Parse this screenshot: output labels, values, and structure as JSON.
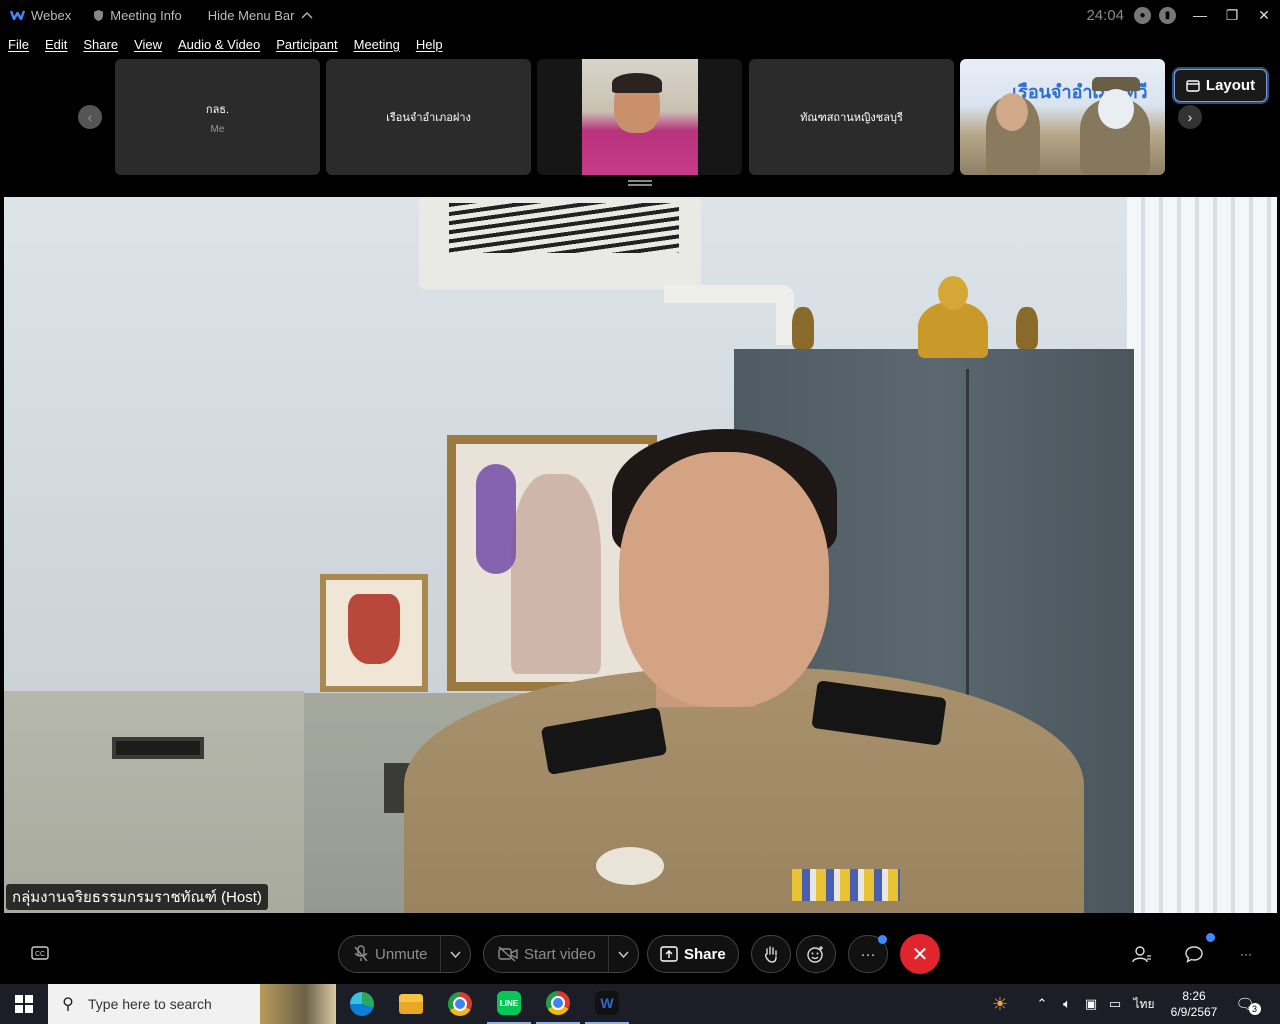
{
  "titlebar": {
    "app_name": "Webex",
    "meeting_info": "Meeting Info",
    "hide_menu_bar": "Hide Menu Bar",
    "time": "24:04"
  },
  "menu": {
    "items": [
      "File",
      "Edit",
      "Share",
      "View",
      "Audio & Video",
      "Participant",
      "Meeting",
      "Help"
    ]
  },
  "filmstrip": {
    "tiles": [
      {
        "name": "กลธ.",
        "sub": "Me"
      },
      {
        "name": "เรือนจำอำเภอฝาง"
      },
      {
        "name": ""
      },
      {
        "name": "ทัณฑสถานหญิงชลบุรี"
      },
      {
        "name": "",
        "banner": "เรือนจำอำเภ...ทวี"
      }
    ],
    "layout_label": "Layout"
  },
  "main_video": {
    "host_label": "กลุ่มงานจริยธรรมกรมราชทัณฑ์ (Host)"
  },
  "controls": {
    "unmute": "Unmute",
    "start_video": "Start video",
    "share": "Share",
    "end_color": "#e0252d",
    "accent": "#3f8cff"
  },
  "taskbar": {
    "search_placeholder": "Type here to search",
    "apps": [
      "edge-icon",
      "file-explorer-icon",
      "chrome-icon",
      "line-icon",
      "chrome-profile-icon",
      "webex-icon"
    ],
    "line_label": "LINE",
    "lang": "ไทย",
    "clock_time": "8:26",
    "clock_date": "6/9/2567",
    "notification_count": "3"
  }
}
